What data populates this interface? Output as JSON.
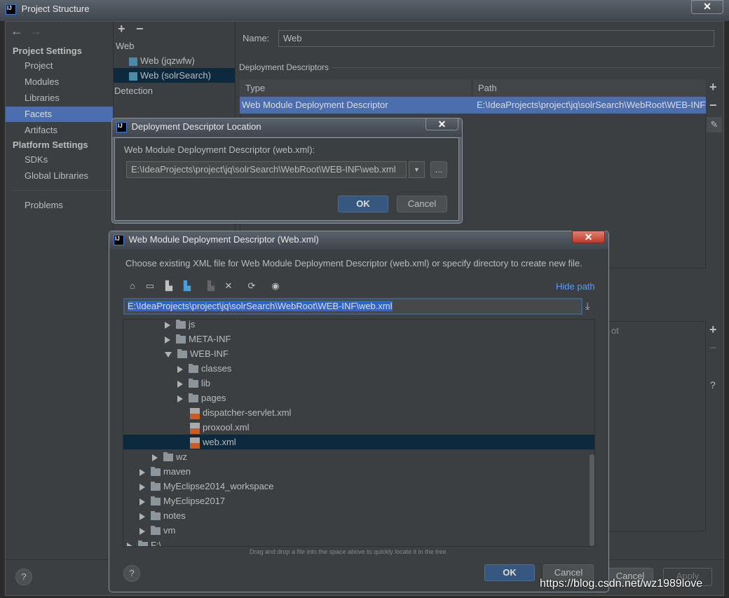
{
  "window": {
    "title": "Project Structure",
    "close": "✕"
  },
  "sidebar": {
    "back": "←",
    "forward": "→",
    "project_settings": "Project Settings",
    "platform_settings": "Platform Settings",
    "items": [
      {
        "label": "Project"
      },
      {
        "label": "Modules"
      },
      {
        "label": "Libraries"
      },
      {
        "label": "Facets"
      },
      {
        "label": "Artifacts"
      }
    ],
    "platform_items": [
      {
        "label": "SDKs"
      },
      {
        "label": "Global Libraries"
      }
    ],
    "problems": "Problems",
    "help": "?"
  },
  "facets": {
    "add": "+",
    "remove": "−",
    "group": "Web",
    "items": [
      {
        "label": "Web (jqzwfw)"
      },
      {
        "label": "Web (solrSearch)"
      }
    ],
    "detection": "Detection"
  },
  "detail": {
    "name_label": "Name:",
    "name_value": "Web",
    "section": "Deployment Descriptors",
    "table": {
      "headers": [
        "Type",
        "Path"
      ],
      "rows": [
        [
          "Web Module Deployment Descriptor",
          "E:\\IdeaProjects\\project\\jq\\solrSearch\\WebRoot\\WEB-INF\\web.xml"
        ]
      ]
    },
    "add": "+",
    "remove": "−",
    "partial_header": "ot",
    "help": "?",
    "cancel": "Cancel",
    "apply": "Apply"
  },
  "dialog1": {
    "title": "Deployment Descriptor Location",
    "close": "✕",
    "label": "Web Module Deployment Descriptor (web.xml):",
    "value": "E:\\IdeaProjects\\project\\jq\\solrSearch\\WebRoot\\WEB-INF\\web.xml",
    "browse": "...",
    "ok": "OK",
    "cancel": "Cancel"
  },
  "dialog2": {
    "title": "Web Module Deployment Descriptor (Web.xml)",
    "close": "✕",
    "description": "Choose existing XML file for Web Module Deployment Descriptor (web.xml) or specify directory to create new file.",
    "hide_path": "Hide path",
    "path": "E:\\IdeaProjects\\project\\jq\\solrSearch\\WebRoot\\WEB-INF\\web.xml",
    "tree": [
      {
        "label": "js",
        "level": 3,
        "type": "folder",
        "state": "closed"
      },
      {
        "label": "META-INF",
        "level": 3,
        "type": "folder",
        "state": "closed"
      },
      {
        "label": "WEB-INF",
        "level": 3,
        "type": "folder",
        "state": "open"
      },
      {
        "label": "classes",
        "level": 4,
        "type": "folder",
        "state": "closed"
      },
      {
        "label": "lib",
        "level": 4,
        "type": "folder",
        "state": "closed"
      },
      {
        "label": "pages",
        "level": 4,
        "type": "folder",
        "state": "closed"
      },
      {
        "label": "dispatcher-servlet.xml",
        "level": 4,
        "type": "xml"
      },
      {
        "label": "proxool.xml",
        "level": 4,
        "type": "xml"
      },
      {
        "label": "web.xml",
        "level": 4,
        "type": "xml",
        "selected": true
      },
      {
        "label": "wz",
        "level": 2,
        "type": "folder",
        "state": "closed"
      },
      {
        "label": "maven",
        "level": 1,
        "type": "folder",
        "state": "closed"
      },
      {
        "label": "MyEclipse2014_workspace",
        "level": 1,
        "type": "folder",
        "state": "closed"
      },
      {
        "label": "MyEclipse2017",
        "level": 1,
        "type": "folder",
        "state": "closed"
      },
      {
        "label": "notes",
        "level": 1,
        "type": "folder",
        "state": "closed"
      },
      {
        "label": "vm",
        "level": 1,
        "type": "folder",
        "state": "closed"
      },
      {
        "label": "F:\\",
        "level": 0,
        "type": "drive",
        "state": "closed"
      }
    ],
    "hint": "Drag and drop a file into the space above to quickly locate it in the tree",
    "help": "?",
    "ok": "OK",
    "cancel": "Cancel"
  },
  "watermark": "https://blog.csdn.net/wz1989love",
  "colors": {
    "accent": "#4b6eaf",
    "tree_selection": "#0d293e",
    "link": "#589df6",
    "ok_button": "#365880"
  }
}
